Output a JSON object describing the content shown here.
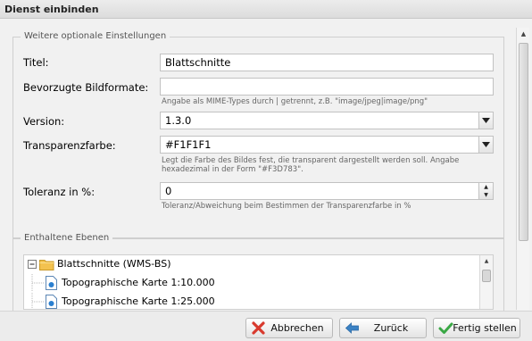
{
  "window": {
    "title": "Dienst einbinden"
  },
  "optional_settings": {
    "legend": "Weitere optionale Einstellungen",
    "title_field": {
      "label": "Titel:",
      "value": "Blattschnitte"
    },
    "formats_field": {
      "label": "Bevorzugte Bildformate:",
      "value": "",
      "hint": "Angabe als MIME-Types durch | getrennt, z.B. \"image/jpeg|image/png\""
    },
    "version_field": {
      "label": "Version:",
      "value": "1.3.0"
    },
    "transparency_field": {
      "label": "Transparenzfarbe:",
      "value": "#F1F1F1",
      "hint_line1": "Legt die Farbe des Bildes fest, die transparent dargestellt werden soll. Angabe",
      "hint_line2": "hexadezimal in der Form \"#F3D783\"."
    },
    "tolerance_field": {
      "label": "Toleranz in %:",
      "value": "0",
      "hint": "Toleranz/Abweichung beim Bestimmen der Transparenzfarbe in %"
    }
  },
  "layers": {
    "legend": "Enthaltene Ebenen",
    "items": [
      {
        "label": "Blattschnitte (WMS-BS)",
        "icon": "folder-icon"
      },
      {
        "label": "Topographische Karte 1:10.000",
        "icon": "file-icon"
      },
      {
        "label": "Topographische Karte 1:25.000",
        "icon": "file-icon"
      }
    ]
  },
  "footer": {
    "cancel_label": "Abbrechen",
    "back_label": "Zurück",
    "finish_label": "Fertig stellen"
  },
  "colors": {
    "cancel_icon": "#d83a2e",
    "back_icon": "#3b82c4",
    "finish_icon": "#3aa845",
    "folder": "#f3c24f"
  }
}
